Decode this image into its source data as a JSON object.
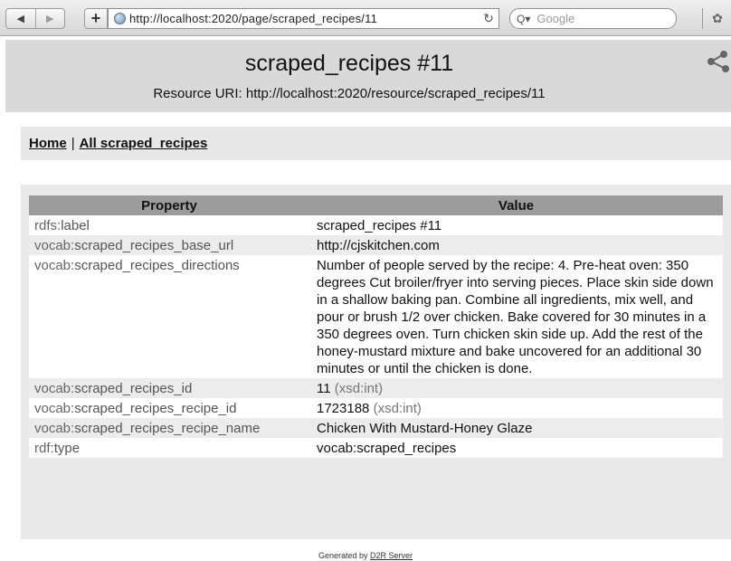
{
  "browser": {
    "url": "http://localhost:2020/page/scraped_recipes/11",
    "search_placeholder": "Google",
    "nav_back_icon": "back-arrow-icon",
    "nav_forward_icon": "forward-arrow-icon"
  },
  "header": {
    "title": "scraped_recipes #11",
    "resource_uri": "Resource URI: http://localhost:2020/resource/scraped_recipes/11"
  },
  "breadcrumb": {
    "home": "Home",
    "separator": "|",
    "all": "All scraped_recipes"
  },
  "table": {
    "headers": {
      "property": "Property",
      "value": "Value"
    },
    "rows": [
      {
        "prefix": "rdfs:",
        "local": "label",
        "value": "scraped_recipes #11",
        "datatype": ""
      },
      {
        "prefix": "vocab:",
        "local": "scraped_recipes_base_url",
        "value": "http://cjskitchen.com",
        "datatype": ""
      },
      {
        "prefix": "vocab:",
        "local": "scraped_recipes_directions",
        "value": "Number of people served by the recipe: 4. Pre-heat oven: 350 degrees Cut broiler/fryer into serving pieces. Place skin side down in a shallow baking pan. Combine all ingredients, mix well, and pour or brush 1/2 over chicken. Bake covered for 30 minutes in a 350 degrees oven. Turn chicken skin side up. Add the rest of the honey-mustard mixture and bake uncovered for an additional 30 minutes or until the chicken is done.",
        "datatype": ""
      },
      {
        "prefix": "vocab:",
        "local": "scraped_recipes_id",
        "value": "11",
        "datatype": "(xsd:int)"
      },
      {
        "prefix": "vocab:",
        "local": "scraped_recipes_recipe_id",
        "value": "1723188",
        "datatype": "(xsd:int)"
      },
      {
        "prefix": "vocab:",
        "local": "scraped_recipes_recipe_name",
        "value": "Chicken With Mustard-Honey Glaze",
        "datatype": ""
      },
      {
        "prefix": "rdf:",
        "local": "type",
        "value": "vocab:scraped_recipes",
        "datatype": ""
      }
    ]
  },
  "footer": {
    "prefix": "Generated by",
    "link": "D2R Server"
  }
}
